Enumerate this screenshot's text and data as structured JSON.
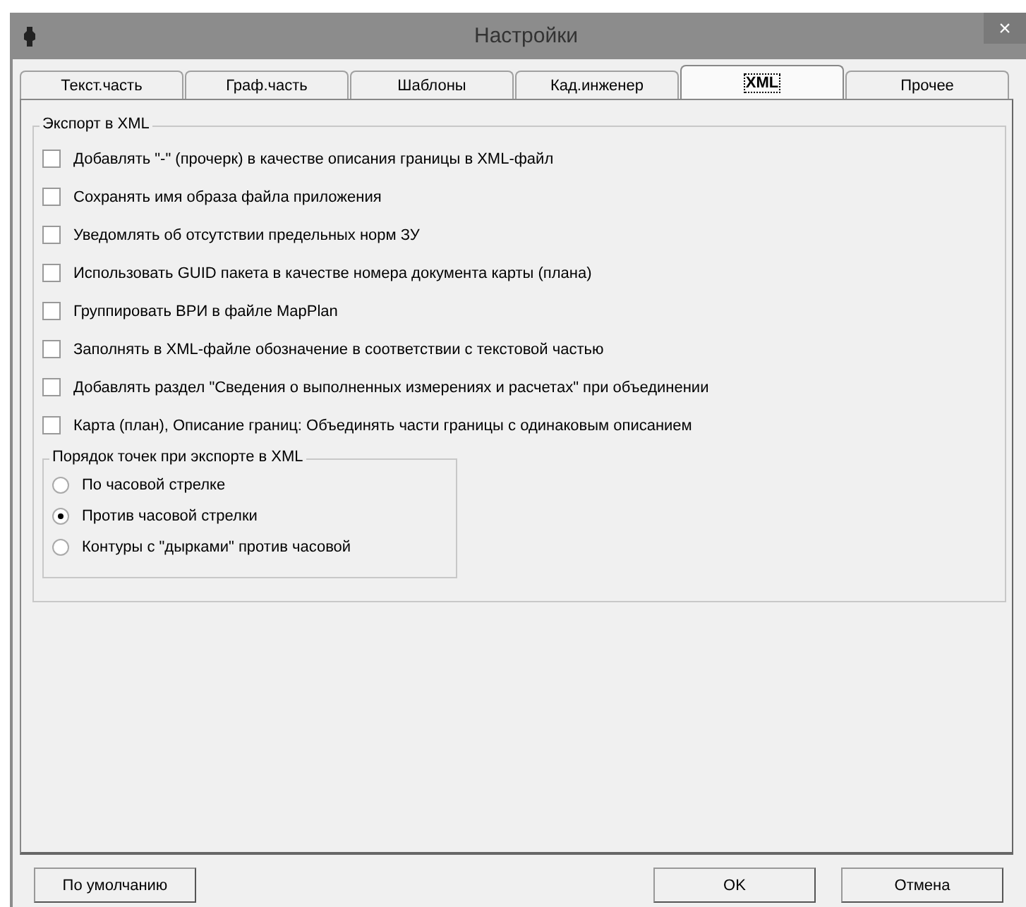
{
  "window": {
    "title": "Настройки",
    "close": "×"
  },
  "tabs": [
    {
      "label": "Текст.часть",
      "selected": false
    },
    {
      "label": "Граф.часть",
      "selected": false
    },
    {
      "label": "Шаблоны",
      "selected": false
    },
    {
      "label": "Кад.инженер",
      "selected": false
    },
    {
      "label": "XML",
      "selected": true
    },
    {
      "label": "Прочее",
      "selected": false
    }
  ],
  "export_group": {
    "title": "Экспорт в XML",
    "options": [
      {
        "label": "Добавлять \"-\" (прочерк) в качестве описания границы в XML-файл",
        "checked": false
      },
      {
        "label": "Сохранять имя образа файла приложения",
        "checked": false
      },
      {
        "label": "Уведомлять об отсутствии предельных норм ЗУ",
        "checked": false
      },
      {
        "label": "Использовать GUID пакета в качестве номера документа карты (плана)",
        "checked": false
      },
      {
        "label": "Группировать ВРИ в файле MapPlan",
        "checked": false
      },
      {
        "label": "Заполнять в XML-файле обозначение в соответствии с текстовой частью",
        "checked": false
      },
      {
        "label": "Добавлять раздел \"Сведения о выполненных измерениях и расчетах\" при объединении",
        "checked": false
      },
      {
        "label": "Карта (план), Описание границ: Объединять части границы с одинаковым описанием",
        "checked": false
      }
    ]
  },
  "order_group": {
    "title": "Порядок точек при экспорте в XML",
    "options": [
      {
        "label": "По часовой стрелке",
        "selected": false
      },
      {
        "label": "Против часовой стрелки",
        "selected": true
      },
      {
        "label": "Контуры с \"дырками\" против часовой",
        "selected": false
      }
    ]
  },
  "buttons": {
    "default": "По умолчанию",
    "ok": "OK",
    "cancel": "Отмена"
  }
}
